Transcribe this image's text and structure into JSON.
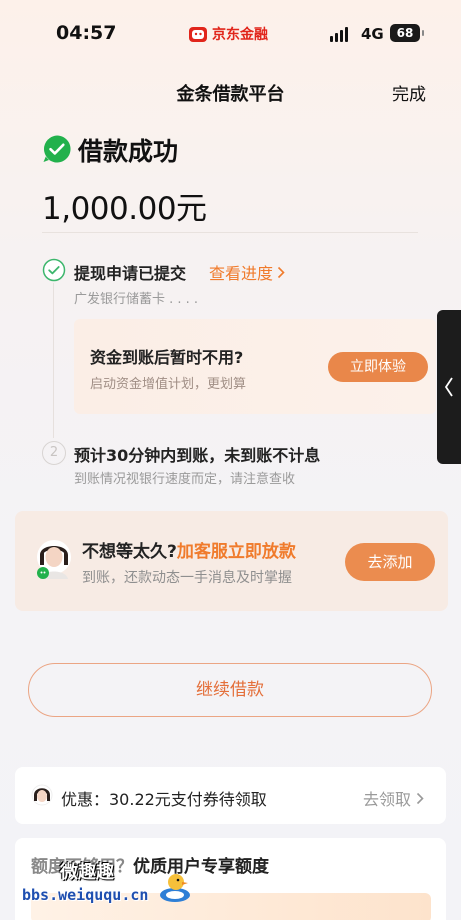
{
  "status_bar": {
    "time": "04:57",
    "brand": "京东金融",
    "network": "4G",
    "battery": "68"
  },
  "nav": {
    "title": "金条借款平台",
    "done": "完成"
  },
  "result": {
    "title": "借款成功",
    "amount": "1,000.00元"
  },
  "steps": [
    {
      "title": "提现申请已提交",
      "link": "查看进度",
      "sub": "广发银行储蓄卡 . . . ."
    },
    {
      "number": "2",
      "title": "预计30分钟内到账，未到账不计息",
      "sub": "到账情况视银行速度而定，请注意查收"
    }
  ],
  "fund_card": {
    "title": "资金到账后暂时不用?",
    "sub": "启动资金增值计划，更划算",
    "button": "立即体验"
  },
  "cs_card": {
    "title": "不想等太久?",
    "title_accent": "加客服立即放款",
    "sub": "到账，还款动态一手消息及时掌握",
    "button": "去添加"
  },
  "continue_button": "继续借款",
  "promo": {
    "text": "优惠：30.22元支付券待领取",
    "link": "去领取"
  },
  "bottom_card": {
    "title_muted": "额度不够用？",
    "title": "优质用户专享额度"
  },
  "watermark": {
    "cn": "微趣趣",
    "url": "bbs.weiququ.cn"
  },
  "icons": {
    "success": "check-circle-icon",
    "step_done": "check-circle-outline-icon",
    "chevron": "chevron-right-icon",
    "side": "chevron-left-icon"
  },
  "colors": {
    "accent": "#f07b2c",
    "success_green": "#22b14c",
    "brand_red": "#e1251b"
  }
}
